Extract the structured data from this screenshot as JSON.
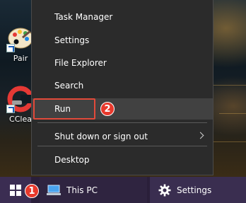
{
  "desktop": {
    "icons": [
      {
        "label": "Pair",
        "icon": "paint-icon"
      },
      {
        "label": "CClea",
        "icon": "ccleaner-icon"
      }
    ]
  },
  "context_menu": {
    "items": [
      {
        "label": "Task Manager"
      },
      {
        "label": "Settings"
      },
      {
        "label": "File Explorer"
      },
      {
        "label": "Search"
      },
      {
        "label": "Run",
        "highlighted": true
      },
      {
        "label": "Shut down or sign out",
        "has_submenu": true
      },
      {
        "label": "Desktop"
      }
    ]
  },
  "annotations": {
    "step_1": "1",
    "step_2": "2"
  },
  "taskbar": {
    "start_icon": "windows-logo-icon",
    "items": [
      {
        "label": "This PC",
        "icon": "computer-icon"
      },
      {
        "label": "Settings",
        "icon": "gear-icon"
      }
    ]
  },
  "colors": {
    "menu_bg": "#2b2b2b",
    "menu_hover": "#414141",
    "annotation_red": "#e8392c",
    "taskbar_bg": "#2a1f3a"
  }
}
